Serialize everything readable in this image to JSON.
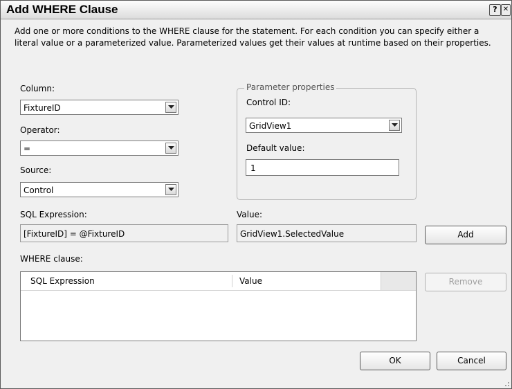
{
  "window": {
    "title": "Add WHERE Clause",
    "help_glyph": "?",
    "close_glyph": "✕"
  },
  "description": "Add one or more conditions to the WHERE clause for the statement. For each condition you can specify either a literal value or a parameterized value. Parameterized values get their values at runtime based on their properties.",
  "column": {
    "label": "Column:",
    "value": "FixtureID"
  },
  "operator": {
    "label": "Operator:",
    "value": "="
  },
  "source": {
    "label": "Source:",
    "value": "Control"
  },
  "parameter_properties": {
    "legend": "Parameter properties",
    "control_id_label": "Control ID:",
    "control_id_value": "GridView1",
    "default_value_label": "Default value:",
    "default_value": "1"
  },
  "sql_expression": {
    "label": "SQL Expression:",
    "value": "[FixtureID] = @FixtureID"
  },
  "value": {
    "label": "Value:",
    "value": "GridView1.SelectedValue"
  },
  "where_clause": {
    "label": "WHERE clause:",
    "columns": [
      "SQL Expression",
      "Value"
    ],
    "rows": []
  },
  "buttons": {
    "add": "Add",
    "remove": "Remove",
    "ok": "OK",
    "cancel": "Cancel"
  }
}
